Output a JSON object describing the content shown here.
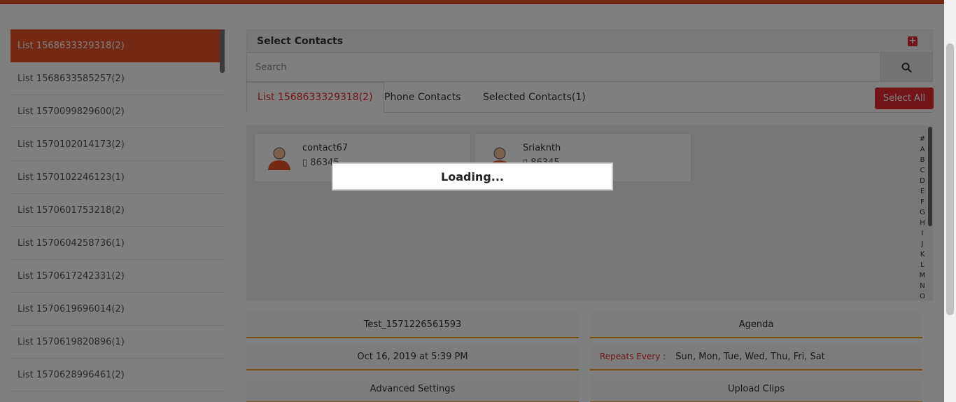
{
  "lists": [
    {
      "label": "List 1568633329318(2)"
    },
    {
      "label": "List 1568633585257(2)"
    },
    {
      "label": "List 1570099829600(2)"
    },
    {
      "label": "List 1570102014173(2)"
    },
    {
      "label": "List 1570102246123(1)"
    },
    {
      "label": "List 1570601753218(2)"
    },
    {
      "label": "List 1570604258736(1)"
    },
    {
      "label": "List 1570617242331(2)"
    },
    {
      "label": "List 1570619696014(2)"
    },
    {
      "label": "List 1570619820896(1)"
    },
    {
      "label": "List 1570628996461(2)"
    }
  ],
  "select_contacts": {
    "title": "Select Contacts"
  },
  "search": {
    "placeholder": "Search"
  },
  "tabs": [
    {
      "label": "List 1568633329318(2)"
    },
    {
      "label": "Phone Contacts"
    },
    {
      "label": "Selected Contacts(1)"
    }
  ],
  "select_all_label": "Select All",
  "contacts": [
    {
      "name": "contact67",
      "phone": "86345..."
    },
    {
      "name": "Sriaknth",
      "phone": "86345..."
    }
  ],
  "alphabet": [
    "#",
    "A",
    "B",
    "C",
    "D",
    "E",
    "F",
    "G",
    "H",
    "I",
    "J",
    "K",
    "L",
    "M",
    "N",
    "O"
  ],
  "fields": {
    "name": "Test_1571226561593",
    "agenda": "Agenda",
    "datetime": "Oct 16, 2019 at 5:39 PM",
    "repeats_label": "Repeats Every :",
    "repeats_value": "Sun, Mon, Tue, Wed, Thu, Fri, Sat",
    "advanced": "Advanced Settings",
    "upload": "Upload Clips"
  },
  "loading_text": "Loading...",
  "colors": {
    "accent": "#e8532b",
    "danger": "#e32a33",
    "underline": "#f0a020"
  }
}
